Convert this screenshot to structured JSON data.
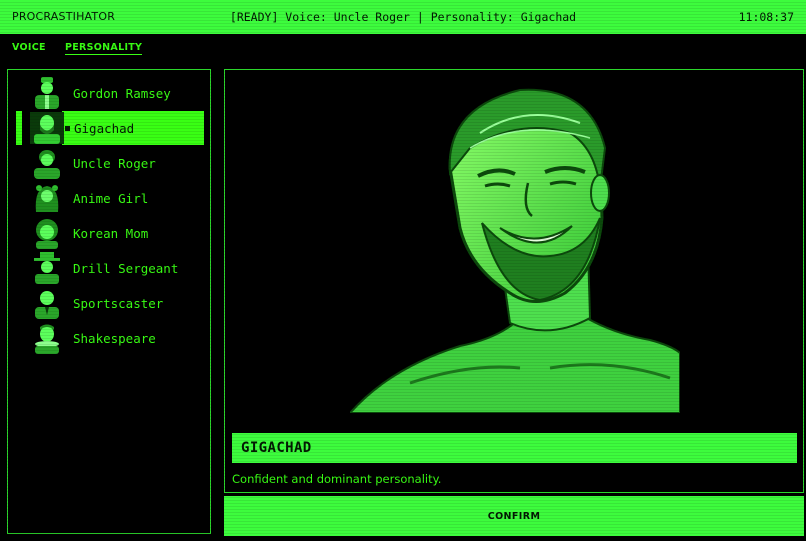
{
  "app": {
    "title": "PROCRASTIHATOR",
    "status": "[READY] Voice: Uncle Roger | Personality: Gigachad",
    "clock": "11:08:37"
  },
  "tabs": [
    {
      "label": "VOICE",
      "active": false
    },
    {
      "label": "PERSONALITY",
      "active": true
    }
  ],
  "personalities": [
    {
      "label": "Gordon Ramsey",
      "icon": "chef-portrait-icon",
      "selected": false
    },
    {
      "label": "Gigachad",
      "icon": "gigachad-portrait-icon",
      "selected": true
    },
    {
      "label": "Uncle Roger",
      "icon": "uncle-roger-portrait-icon",
      "selected": false
    },
    {
      "label": "Anime Girl",
      "icon": "anime-girl-portrait-icon",
      "selected": false
    },
    {
      "label": "Korean Mom",
      "icon": "korean-mom-portrait-icon",
      "selected": false
    },
    {
      "label": "Drill Sergeant",
      "icon": "drill-sergeant-portrait-icon",
      "selected": false
    },
    {
      "label": "Sportscaster",
      "icon": "sportscaster-portrait-icon",
      "selected": false
    },
    {
      "label": "Shakespeare",
      "icon": "shakespeare-portrait-icon",
      "selected": false
    }
  ],
  "detail": {
    "name": "GIGACHAD",
    "description": "Confident and dominant personality."
  },
  "confirm_label": "CONFIRM",
  "colors": {
    "accent": "#3dfc3d",
    "text": "#39ff14",
    "background": "#000000"
  }
}
